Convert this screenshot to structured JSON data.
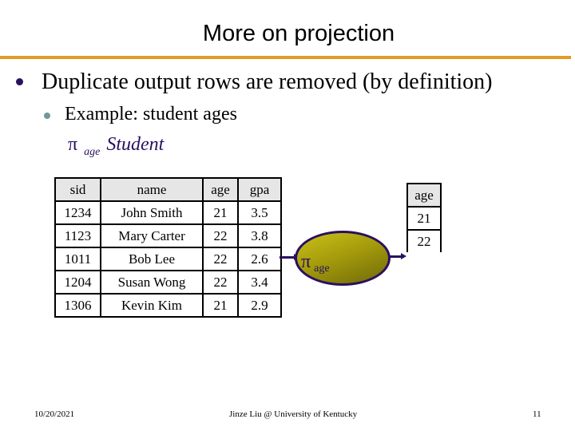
{
  "slide": {
    "title": "More on projection",
    "bullets": [
      {
        "level": 1,
        "text": "Duplicate output rows are removed (by definition)"
      },
      {
        "level": 2,
        "text": "Example: student ages"
      }
    ],
    "formula": {
      "operator": "π",
      "subscript": "age",
      "relation": "Student"
    },
    "accent_color": "#e09a26",
    "student_table": {
      "headers": [
        "sid",
        "name",
        "age",
        "gpa"
      ],
      "rows": [
        [
          "1234",
          "John Smith",
          "21",
          "3.5"
        ],
        [
          "1123",
          "Mary Carter",
          "22",
          "3.8"
        ],
        [
          "1011",
          "Bob Lee",
          "22",
          "2.6"
        ],
        [
          "1204",
          "Susan Wong",
          "22",
          "3.4"
        ],
        [
          "1306",
          "Kevin Kim",
          "21",
          "2.9"
        ]
      ]
    },
    "operator_node": {
      "symbol": "π",
      "subscript": "age"
    },
    "result_table": {
      "headers": [
        "age"
      ],
      "rows": [
        [
          "21"
        ],
        [
          "22"
        ]
      ]
    },
    "footer": {
      "date": "10/20/2021",
      "author": "Jinze Liu @ University of Kentucky",
      "page": "11"
    }
  }
}
